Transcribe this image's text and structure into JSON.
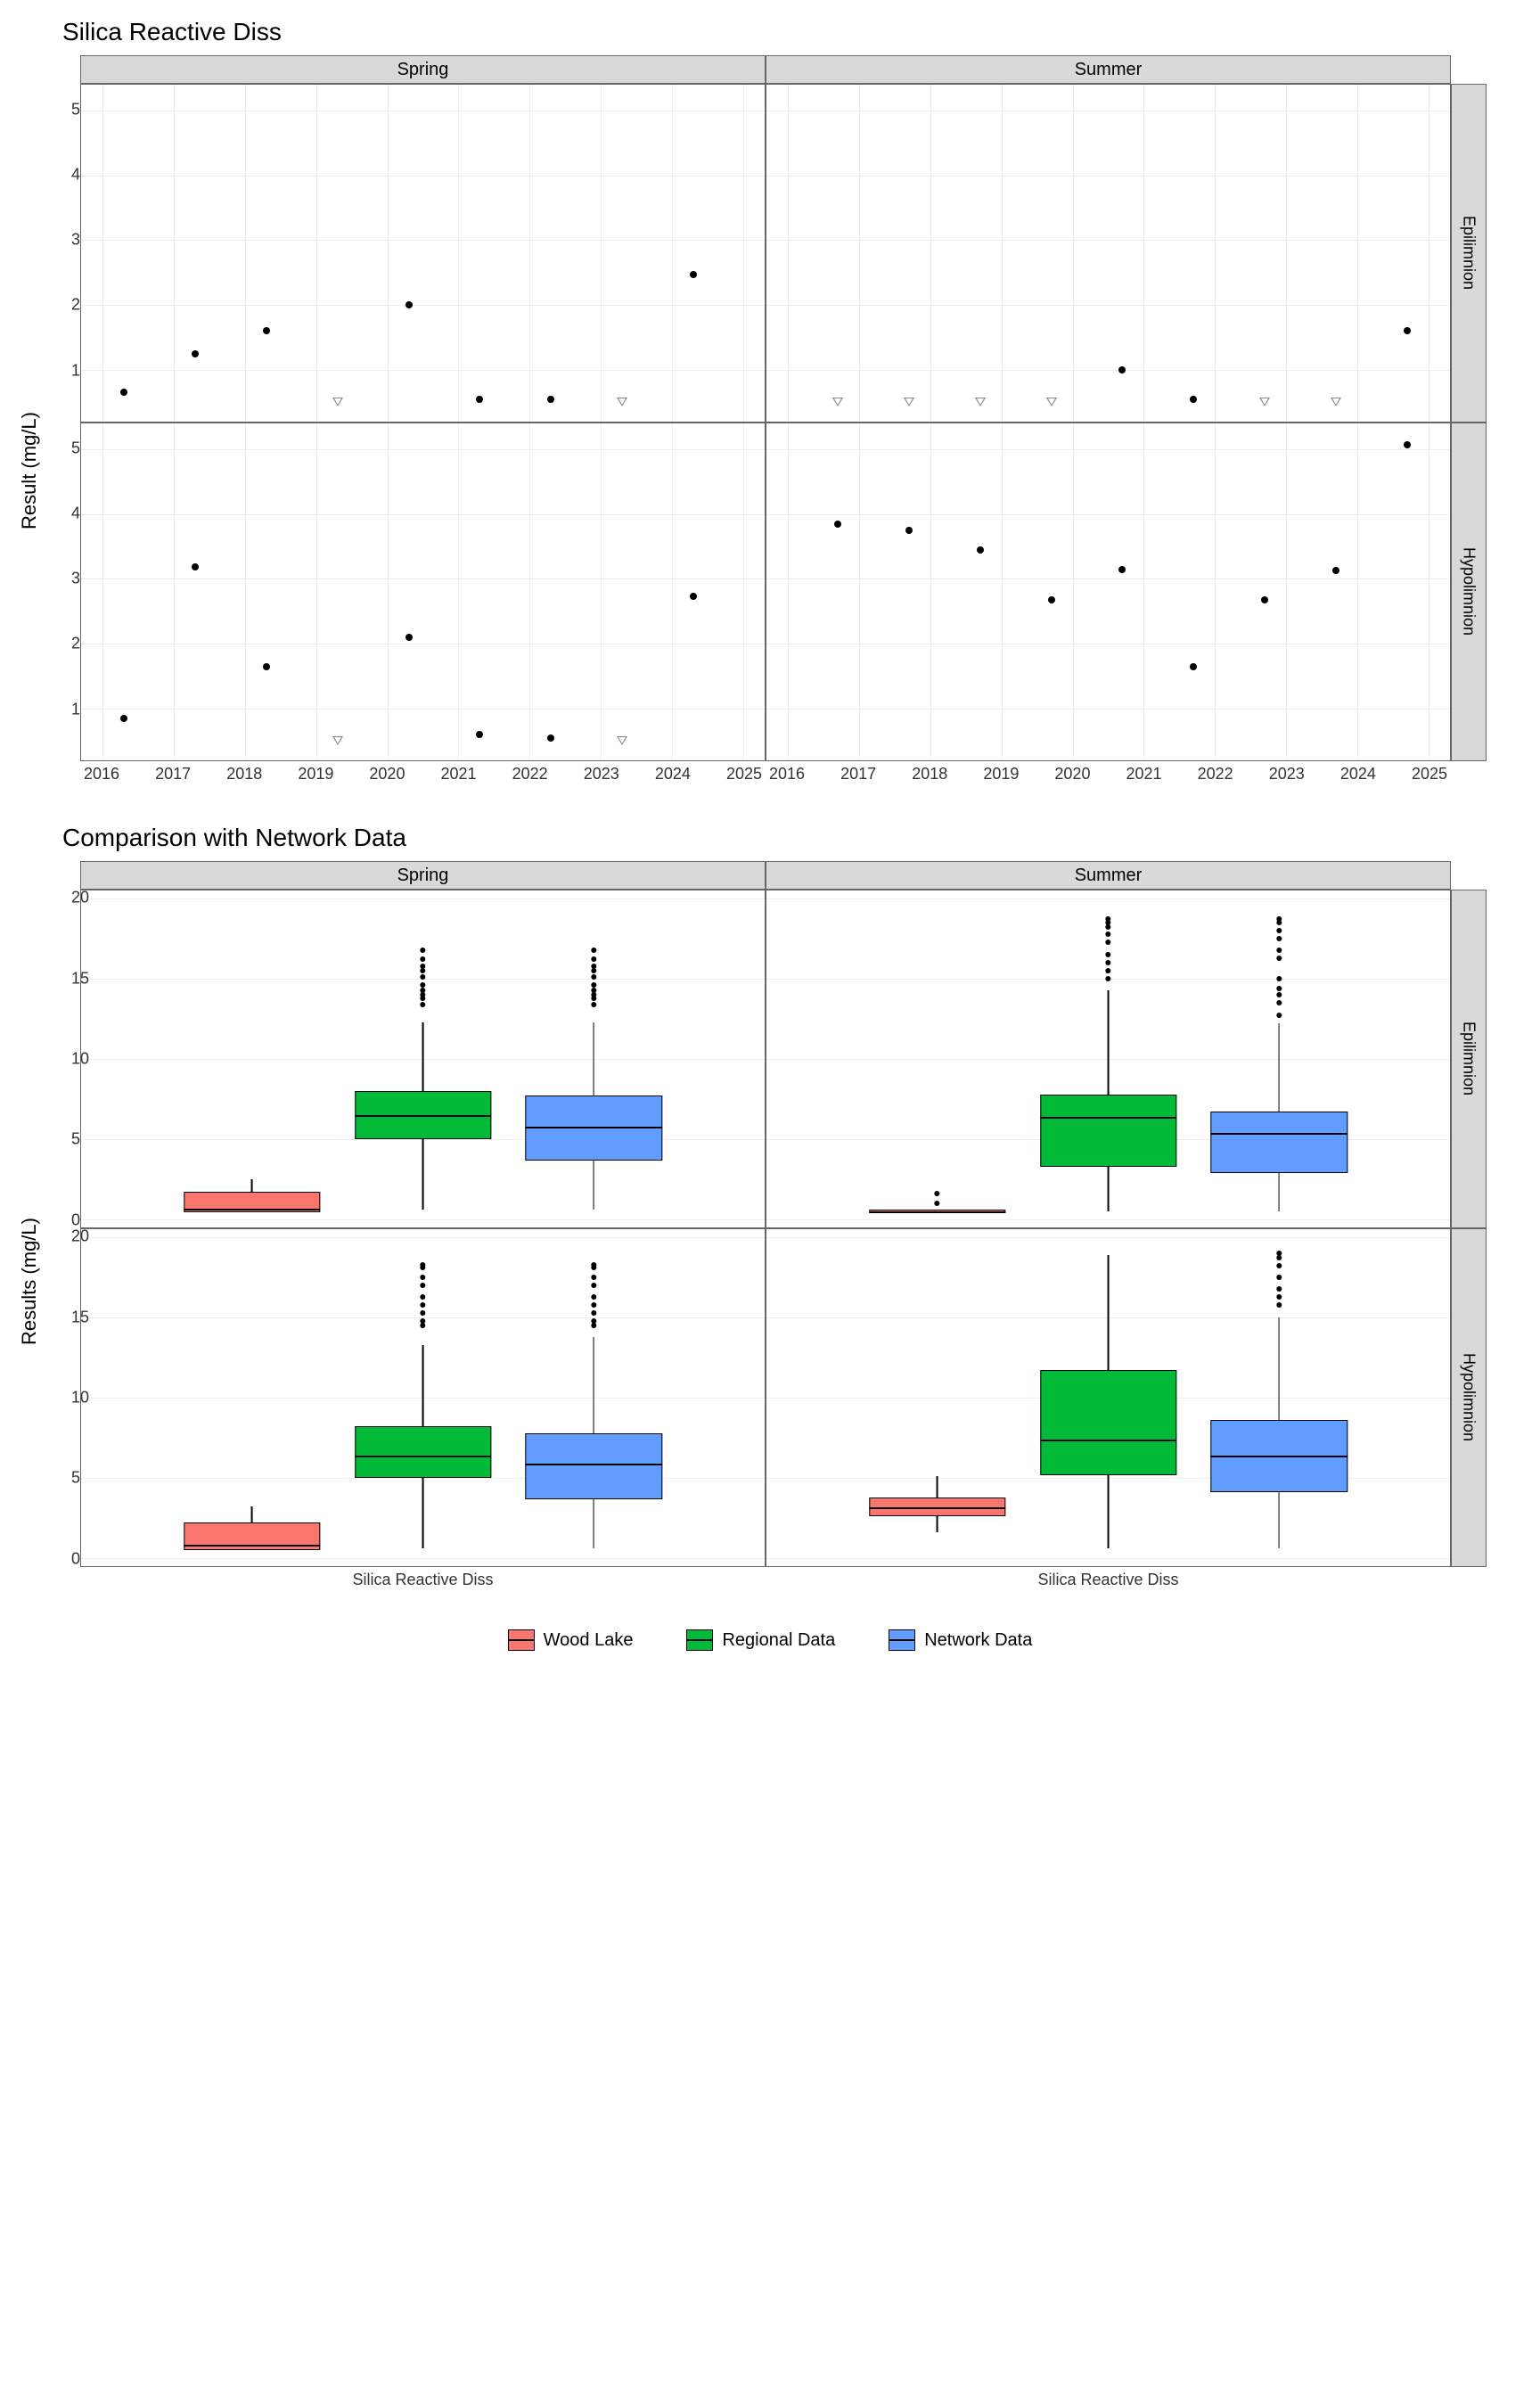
{
  "chart_data": [
    {
      "type": "scatter",
      "title": "Silica Reactive Diss",
      "ylabel": "Result (mg/L)",
      "x_ticks": [
        2016,
        2017,
        2018,
        2019,
        2020,
        2021,
        2022,
        2023,
        2024,
        2025
      ],
      "y_ticks": [
        1,
        2,
        3,
        4,
        5
      ],
      "xlim": [
        2015.7,
        2025.3
      ],
      "ylim": [
        0.2,
        5.4
      ],
      "col_facets": [
        "Spring",
        "Summer"
      ],
      "row_facets": [
        "Epilimnion",
        "Hypolimnion"
      ],
      "panels": {
        "Spring_Epilimnion": {
          "points": [
            {
              "x": 2016.3,
              "y": 0.65
            },
            {
              "x": 2017.3,
              "y": 1.25
            },
            {
              "x": 2018.3,
              "y": 1.6
            },
            {
              "x": 2020.3,
              "y": 2.0
            },
            {
              "x": 2021.3,
              "y": 0.55
            },
            {
              "x": 2022.3,
              "y": 0.55
            },
            {
              "x": 2024.3,
              "y": 2.47
            }
          ],
          "open": [
            {
              "x": 2019.3,
              "y": 0.5
            },
            {
              "x": 2023.3,
              "y": 0.5
            }
          ]
        },
        "Summer_Epilimnion": {
          "points": [
            {
              "x": 2020.7,
              "y": 1.0
            },
            {
              "x": 2021.7,
              "y": 0.55
            },
            {
              "x": 2024.7,
              "y": 1.6
            }
          ],
          "open": [
            {
              "x": 2016.7,
              "y": 0.5
            },
            {
              "x": 2017.7,
              "y": 0.5
            },
            {
              "x": 2018.7,
              "y": 0.5
            },
            {
              "x": 2019.7,
              "y": 0.5
            },
            {
              "x": 2022.7,
              "y": 0.5
            },
            {
              "x": 2023.7,
              "y": 0.5
            }
          ]
        },
        "Spring_Hypolimnion": {
          "points": [
            {
              "x": 2016.3,
              "y": 0.85
            },
            {
              "x": 2017.3,
              "y": 3.18
            },
            {
              "x": 2018.3,
              "y": 1.65
            },
            {
              "x": 2020.3,
              "y": 2.1
            },
            {
              "x": 2021.3,
              "y": 0.6
            },
            {
              "x": 2022.3,
              "y": 0.55
            },
            {
              "x": 2024.3,
              "y": 2.73
            }
          ],
          "open": [
            {
              "x": 2019.3,
              "y": 0.5
            },
            {
              "x": 2023.3,
              "y": 0.5
            }
          ]
        },
        "Summer_Hypolimnion": {
          "points": [
            {
              "x": 2016.7,
              "y": 3.85
            },
            {
              "x": 2017.7,
              "y": 3.75
            },
            {
              "x": 2018.7,
              "y": 3.45
            },
            {
              "x": 2019.7,
              "y": 2.68
            },
            {
              "x": 2020.7,
              "y": 3.15
            },
            {
              "x": 2021.7,
              "y": 1.65
            },
            {
              "x": 2022.7,
              "y": 2.68
            },
            {
              "x": 2023.7,
              "y": 3.13
            },
            {
              "x": 2024.7,
              "y": 5.07
            }
          ],
          "open": []
        }
      }
    },
    {
      "type": "boxplot",
      "title": "Comparison with Network Data",
      "ylabel": "Results (mg/L)",
      "y_ticks": [
        0,
        5,
        10,
        15,
        20
      ],
      "ylim": [
        -0.5,
        20.5
      ],
      "col_facets": [
        "Spring",
        "Summer"
      ],
      "row_facets": [
        "Epilimnion",
        "Hypolimnion"
      ],
      "x_category": "Silica Reactive Diss",
      "series_colors": {
        "Wood Lake": "#f8766d",
        "Regional Data": "#00ba38",
        "Network Data": "#619cff"
      },
      "legend": [
        "Wood Lake",
        "Regional Data",
        "Network Data"
      ],
      "panels": {
        "Spring_Epilimnion": {
          "boxes": [
            {
              "name": "Wood Lake",
              "min": 0.5,
              "q1": 0.55,
              "med": 0.65,
              "q3": 1.7,
              "max": 2.5,
              "out": []
            },
            {
              "name": "Regional Data",
              "min": 0.6,
              "q1": 5.1,
              "med": 6.5,
              "q3": 8.0,
              "max": 12.3,
              "out": [
                13.4,
                13.8,
                14.0,
                14.3,
                14.6,
                15.1,
                15.5,
                15.8,
                16.2,
                16.8
              ]
            },
            {
              "name": "Network Data",
              "min": 0.6,
              "q1": 3.8,
              "med": 5.8,
              "q3": 7.7,
              "max": 12.3,
              "out": [
                13.4,
                13.8,
                14.0,
                14.3,
                14.6,
                15.1,
                15.5,
                15.8,
                16.2,
                16.8
              ]
            }
          ]
        },
        "Summer_Epilimnion": {
          "boxes": [
            {
              "name": "Wood Lake",
              "min": 0.5,
              "q1": 0.5,
              "med": 0.5,
              "q3": 0.6,
              "max": 0.6,
              "out": [
                1.0,
                1.6
              ]
            },
            {
              "name": "Regional Data",
              "min": 0.5,
              "q1": 3.4,
              "med": 6.4,
              "q3": 7.8,
              "max": 14.3,
              "out": [
                15.0,
                15.5,
                16.0,
                16.5,
                17.3,
                17.8,
                18.2,
                18.5,
                18.7
              ]
            },
            {
              "name": "Network Data",
              "min": 0.5,
              "q1": 3.0,
              "med": 5.4,
              "q3": 6.7,
              "max": 12.2,
              "out": [
                12.7,
                13.5,
                14.0,
                14.4,
                15.0,
                16.3,
                16.8,
                17.5,
                18.0,
                18.5,
                18.7
              ]
            }
          ]
        },
        "Spring_Hypolimnion": {
          "boxes": [
            {
              "name": "Wood Lake",
              "min": 0.5,
              "q1": 0.6,
              "med": 0.85,
              "q3": 2.2,
              "max": 3.2,
              "out": []
            },
            {
              "name": "Regional Data",
              "min": 0.6,
              "q1": 5.1,
              "med": 6.4,
              "q3": 8.2,
              "max": 13.3,
              "out": [
                14.5,
                14.8,
                15.3,
                15.8,
                16.3,
                17.0,
                17.5,
                18.1,
                18.3
              ]
            },
            {
              "name": "Network Data",
              "min": 0.6,
              "q1": 3.8,
              "med": 5.9,
              "q3": 7.8,
              "max": 13.8,
              "out": [
                14.5,
                14.8,
                15.3,
                15.8,
                16.3,
                17.0,
                17.5,
                18.1,
                18.3
              ]
            }
          ]
        },
        "Summer_Hypolimnion": {
          "boxes": [
            {
              "name": "Wood Lake",
              "min": 1.6,
              "q1": 2.7,
              "med": 3.15,
              "q3": 3.8,
              "max": 5.1,
              "out": []
            },
            {
              "name": "Regional Data",
              "min": 0.6,
              "q1": 5.3,
              "med": 7.4,
              "q3": 11.7,
              "max": 18.9,
              "out": []
            },
            {
              "name": "Network Data",
              "min": 0.6,
              "q1": 4.2,
              "med": 6.4,
              "q3": 8.6,
              "max": 15.0,
              "out": [
                15.8,
                16.3,
                16.8,
                17.5,
                18.2,
                18.7,
                19.0
              ]
            }
          ]
        }
      }
    }
  ]
}
